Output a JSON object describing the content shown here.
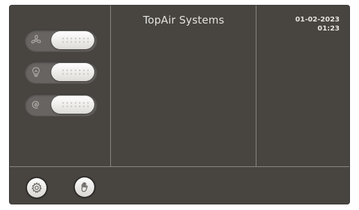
{
  "header": {
    "title": "TopAir Systems",
    "date": "01-02-2023",
    "time": "01:23"
  },
  "toggles": [
    {
      "name": "fan",
      "icon": "fan-icon",
      "state": "off"
    },
    {
      "name": "light",
      "icon": "lightbulb-icon",
      "state": "off"
    },
    {
      "name": "swing",
      "icon": "swirl-icon",
      "state": "off"
    }
  ],
  "footer": {
    "buttons": [
      {
        "name": "settings",
        "icon": "gear-icon"
      },
      {
        "name": "manual",
        "icon": "hand-icon"
      }
    ]
  },
  "colors": {
    "panel": "#484541",
    "text": "#e6e4df",
    "divider": "#8c8983",
    "toggle_track": "#676462",
    "toggle_knob": "#ffffff"
  }
}
